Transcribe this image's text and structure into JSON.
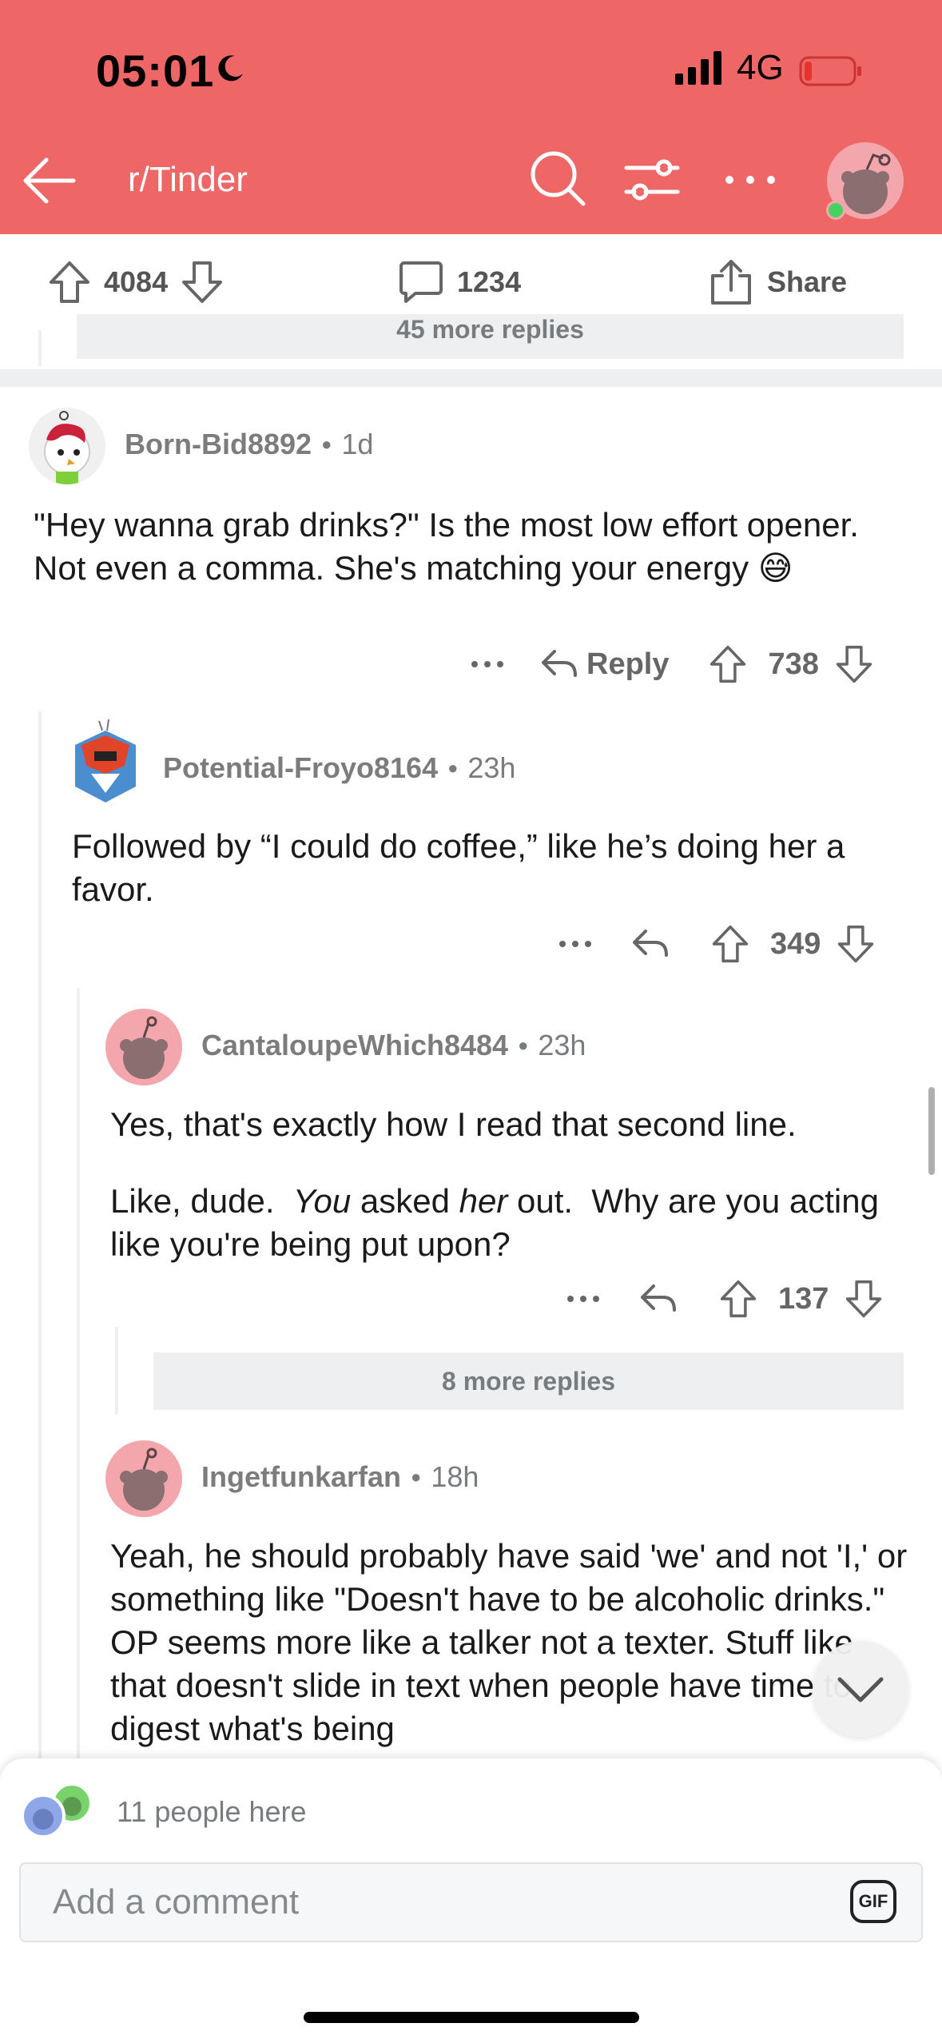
{
  "status_bar": {
    "time": "05:01",
    "network": "4G"
  },
  "header": {
    "subreddit": "r/Tinder"
  },
  "action_bar": {
    "upvotes": "4084",
    "comments": "1234",
    "share_label": "Share"
  },
  "top_more_replies": "45 more replies",
  "comments": [
    {
      "user": "Born-Bid8892",
      "age": "1d",
      "body": "\"Hey wanna grab drinks?\" Is the most low effort opener. Not even a comma. She's matching your energy 😅",
      "reply_label": "Reply",
      "votes": "738"
    },
    {
      "user": "Potential-Froyo8164",
      "age": "23h",
      "body": "Followed by “I could do coffee,” like he’s doing her a favor.",
      "votes": "349"
    },
    {
      "user": "CantaloupeWhich8484",
      "age": "23h",
      "body_p1": "Yes, that's exactly how I read that second line.",
      "body_p2_a": "Like, dude.  ",
      "body_p2_b": "You",
      "body_p2_c": " asked ",
      "body_p2_d": "her",
      "body_p2_e": " out.  Why are you acting like you're being put upon?",
      "votes": "137",
      "more_replies": "8 more replies"
    },
    {
      "user": "Ingetfunkarfan",
      "age": "18h",
      "body": "Yeah, he should probably have said 'we' and not 'I,' or something like \"Doesn't have to be alcoholic drinks.\" OP seems more like a talker not a texter. Stuff like that doesn't slide in text when people have time to digest what's being"
    }
  ],
  "composer": {
    "people_here": "11 people here",
    "placeholder": "Add a comment",
    "gif_label": "GIF"
  }
}
